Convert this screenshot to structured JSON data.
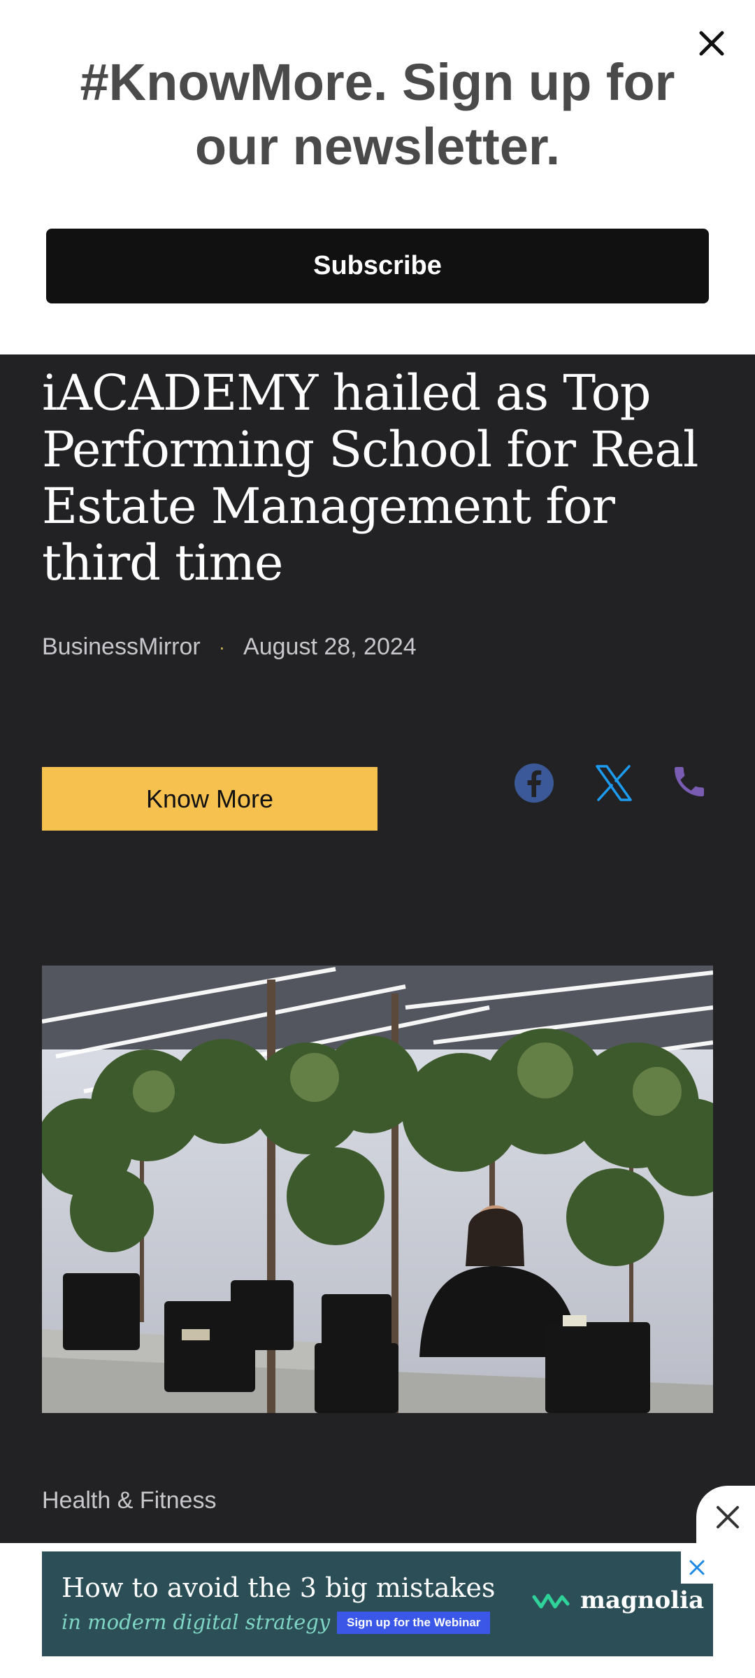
{
  "newsletter": {
    "title": "#KnowMore. Sign up for our newsletter.",
    "subscribe_label": "Subscribe"
  },
  "article": {
    "title": "iACADEMY hailed as Top Performing School for Real Estate Management for third time",
    "source": "BusinessMirror",
    "separator": "·",
    "date": "August 28, 2024",
    "know_more_label": "Know More",
    "category": "Health & Fitness"
  },
  "share": {
    "icons": [
      "facebook-icon",
      "x-icon",
      "phone-icon"
    ],
    "colors": {
      "facebook": "#3b5998",
      "x": "#1d9bf0",
      "phone": "#7b5cb3"
    }
  },
  "ad": {
    "line1": "How to avoid the 3 big mistakes",
    "line2": "in modern digital strategy",
    "cta": "Sign up for the Webinar",
    "brand": "magnolia"
  },
  "colors": {
    "background": "#222224",
    "accent": "#f6c14f",
    "subscribe_bg": "#111111"
  }
}
